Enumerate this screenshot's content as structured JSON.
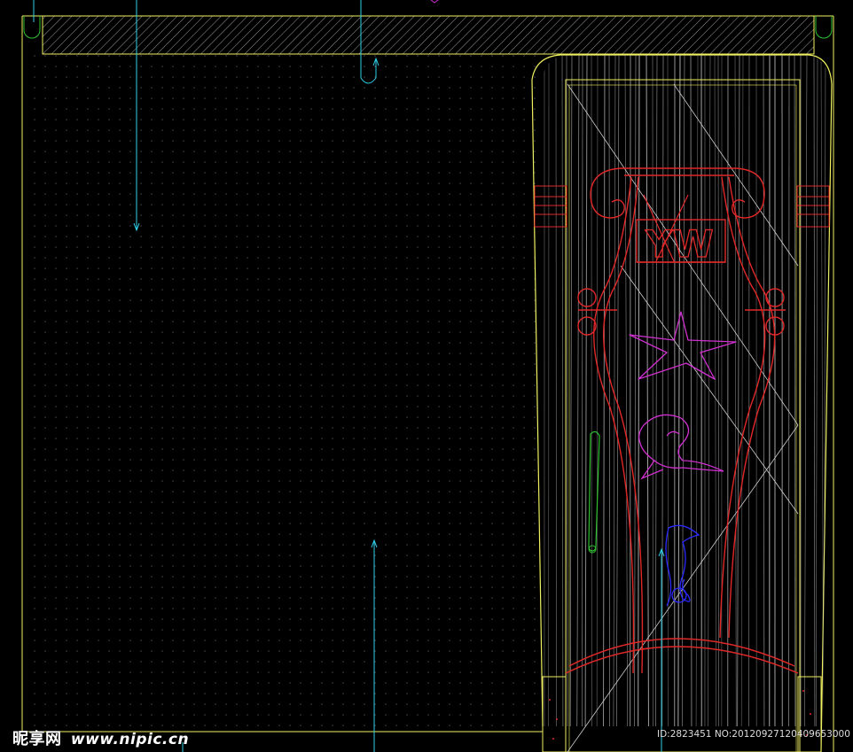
{
  "drawing": {
    "emblem_text": "YW",
    "motifs": [
      "starfish",
      "sailfish",
      "seahorse"
    ]
  },
  "colors": {
    "background": "#000000",
    "outline": "#f0f060",
    "ornament": "#e02828",
    "magenta": "#d030d0",
    "blue": "#2a2aff",
    "cyan": "#30d0e8",
    "green": "#30c030",
    "grain": "#bcbcbc",
    "dots": "#4a4a5a"
  },
  "watermark": {
    "logo_cn": "昵享网",
    "logo_url": "www.nipic.cn",
    "id_text": "ID:2823451 NO:20120927120409653000"
  }
}
